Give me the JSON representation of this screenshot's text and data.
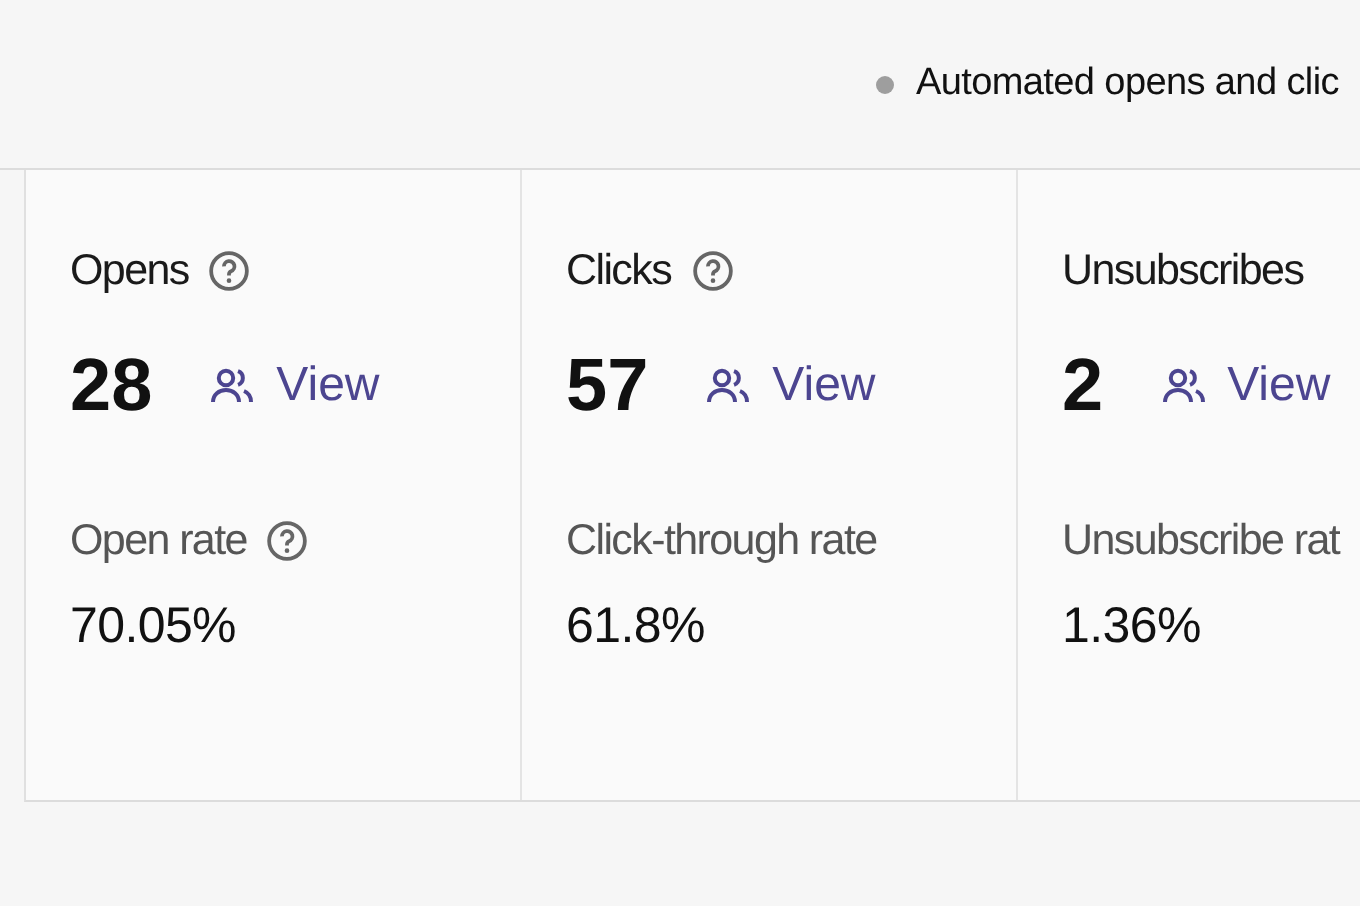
{
  "legend": {
    "label": "Automated opens and clic",
    "color": "#9e9e9e"
  },
  "metrics": [
    {
      "label": "Opens",
      "help": true,
      "value": "28",
      "link": "View",
      "rate_label": "Open rate",
      "rate_help": true,
      "rate": "70.05%"
    },
    {
      "label": "Clicks",
      "help": true,
      "value": "57",
      "link": "View",
      "rate_label": "Click-through rate",
      "rate_help": false,
      "rate": "61.8%"
    },
    {
      "label": "Unsubscribes",
      "help": false,
      "value": "2",
      "link": "View",
      "rate_label": "Unsubscribe rat",
      "rate_help": false,
      "rate": "1.36%"
    }
  ]
}
